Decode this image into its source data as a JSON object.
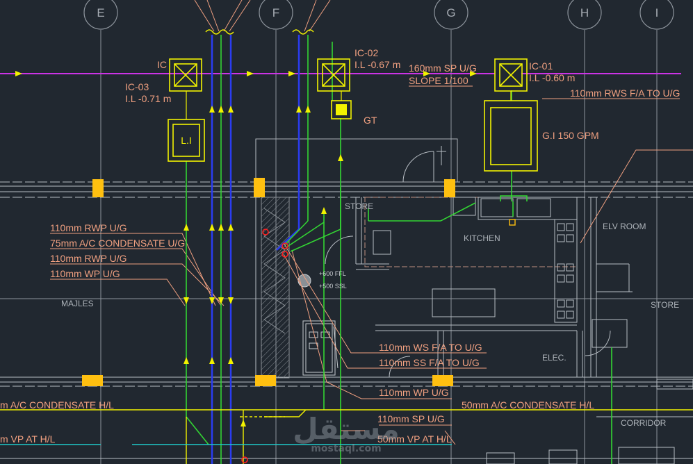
{
  "grid_axes": [
    "E",
    "F",
    "G",
    "H",
    "I"
  ],
  "chambers": {
    "ic": "IC",
    "ic_03": "IC-03",
    "ic_03_level": "I.L -0.71 m",
    "ic_02": "IC-02",
    "ic_02_level": "I.L -0.67 m",
    "ic_01": "IC-01",
    "ic_01_level": "I.L -0.60 m",
    "li": "L.I",
    "gt": "GT",
    "gi": "G.I 150 GPM"
  },
  "pipes": {
    "sp_main": "160mm SP U/G",
    "slope": "SLOPE 1/100",
    "rws": "110mm RWS F/A TO U/G",
    "rwp1": "110mm RWP U/G",
    "ac75": "75mm A/C CONDENSATE U/G",
    "rwp2": "110mm RWP U/G",
    "wp": "110mm WP U/G",
    "ws": "110mm WS F/A TO U/G",
    "ss": "110mm SS F/A TO U/G",
    "wp2": "110mm WP U/G",
    "ac50_left": "m A/C CONDENSATE H/L",
    "ac50_right": "50mm A/C CONDENSATE H/L",
    "sp2": "110mm SP U/G",
    "vp_left": "m VP AT H/L",
    "vp_right": "50mm VP AT H/L"
  },
  "rooms": {
    "store1": "STORE",
    "kitchen": "KITCHEN",
    "elv": "ELV ROOM",
    "majles": "MAJLES",
    "store2": "STORE",
    "elec": "ELEC.",
    "corridor": "CORRIDOR"
  },
  "levels": {
    "ffl": "+600  FFL",
    "ssl": "+500  SSL"
  },
  "watermark": {
    "arabic": "مستقل",
    "latin": "mostaql.com"
  },
  "colors": {
    "background": "#212830",
    "grid": "#8d949c",
    "magenta": "#cc33e6",
    "yellow": "#f2f200",
    "green": "#33d633",
    "blue": "#2a3cf0",
    "salmon": "#f0a080",
    "wall": "#b8bec4",
    "cyan": "#1fc9c9",
    "orange": "#ffc010"
  }
}
